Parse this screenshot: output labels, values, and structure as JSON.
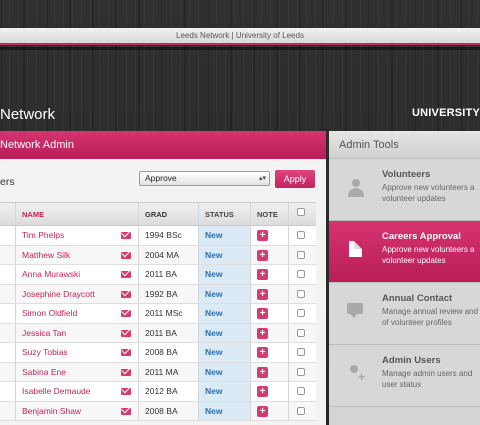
{
  "window": {
    "title": "Leeds Network | University of Leeds"
  },
  "brand": {
    "left": "Network",
    "right": "UNIVERSITY"
  },
  "main": {
    "header": "Network Admin",
    "filter_label": "ers",
    "select_value": "Approve",
    "apply_label": "Apply",
    "columns": {
      "name": "NAME",
      "grad": "GRAD",
      "status": "STATUS",
      "note": "NOTE"
    },
    "rows": [
      {
        "name": "Tim Phelps",
        "grad": "1994 BSc",
        "status": "New"
      },
      {
        "name": "Matthew Silk",
        "grad": "2004 MA",
        "status": "New"
      },
      {
        "name": "Anna Murawski",
        "grad": "2011 BA",
        "status": "New"
      },
      {
        "name": "Josephine Draycott",
        "grad": "1992 BA",
        "status": "New"
      },
      {
        "name": "Simon Oldfield",
        "grad": "2011 MSc",
        "status": "New"
      },
      {
        "name": "Jessica Tan",
        "grad": "2011 BA",
        "status": "New"
      },
      {
        "name": "Suzy Tobias",
        "grad": "2008 BA",
        "status": "New"
      },
      {
        "name": "Sabina Ene",
        "grad": "2011 MA",
        "status": "New"
      },
      {
        "name": "Isabelle Demaude",
        "grad": "2012 BA",
        "status": "New"
      },
      {
        "name": "Benjamin Shaw",
        "grad": "2008 BA",
        "status": "New"
      }
    ],
    "note_button": "+"
  },
  "sidebar": {
    "header": "Admin Tools",
    "items": [
      {
        "title": "Volunteers",
        "desc1": "Approve new volunteers a",
        "desc2": "volunteer updates",
        "icon": "person-icon"
      },
      {
        "title": "Careers Approval",
        "desc1": "Approve new volunteers a",
        "desc2": "volunteer updates",
        "icon": "document-icon"
      },
      {
        "title": "Annual Contact",
        "desc1": "Manage annual review and",
        "desc2": "of volunteer profiles",
        "icon": "chat-icon"
      },
      {
        "title": "Admin Users",
        "desc1": "Manage admin users and",
        "desc2": "user status",
        "icon": "add-user-icon"
      }
    ]
  },
  "colors": {
    "accent": "#c8265f",
    "status_text": "#2a6fb0",
    "status_bg": "#dbeaf4"
  }
}
